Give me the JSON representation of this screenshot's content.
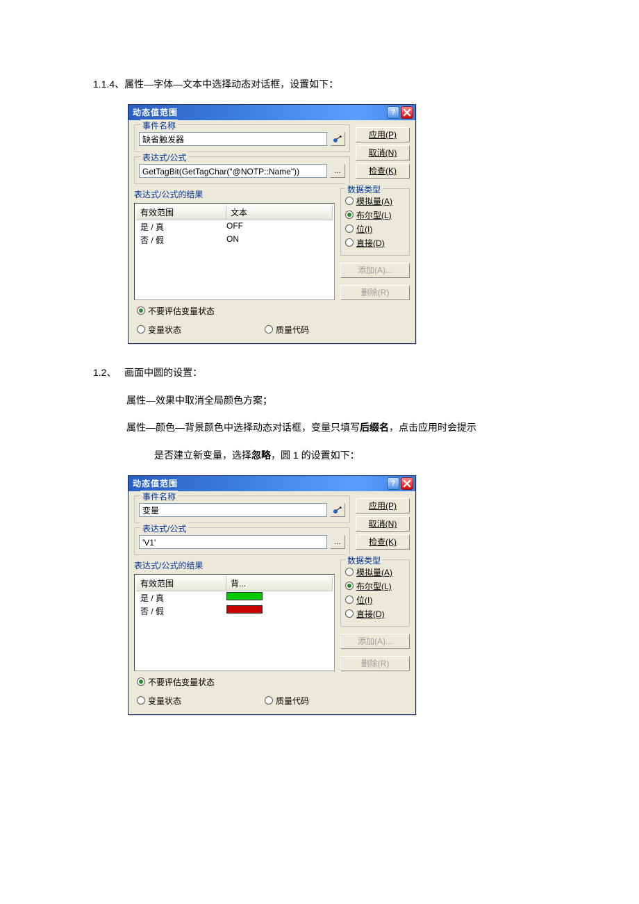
{
  "doc": {
    "p1": "1.1.4、属性—字体—文本中选择动态对话框，设置如下：",
    "p2a": "1.2、",
    "p2b": "画面中圆的设置：",
    "p3": "属性—效果中取消全局颜色方案；",
    "p4a": "属性—颜色—背景颜色中选择动态对话框，变量只填写",
    "p4b": "后缀名",
    "p4c": "，点击应用时会提示",
    "p5a": "是否建立新变量，选择",
    "p5b": "忽略",
    "p5c": "，圆 1 的设置如下："
  },
  "dialog1": {
    "title": "动态值范围",
    "event_group": "事件名称",
    "event_value": "缺省触发器",
    "expr_group": "表达式/公式",
    "expr_value": "GetTagBit(GetTagChar(\"@NOTP::Name\"))",
    "result_group": "表达式/公式的结果",
    "col_a": "有效范围",
    "col_b": "文本",
    "rows": [
      {
        "a": "是 / 真",
        "b": "OFF"
      },
      {
        "a": "否 / 假",
        "b": "ON"
      }
    ],
    "datatype_label": "数据类型",
    "radios": {
      "analog": "模拟量(A)",
      "bool": "布尔型(L)",
      "bit": "位(I)",
      "direct": "直接(D)"
    },
    "btns": {
      "apply": "应用(P)",
      "cancel": "取消(N)",
      "check": "检查(K)",
      "add": "添加(A)...",
      "remove": "删除(R)",
      "ellipsis": "..."
    },
    "bottom": {
      "noeval": "不要评估变量状态",
      "varstate": "变量状态",
      "quality": "质量代码"
    }
  },
  "dialog2": {
    "title": "动态值范围",
    "event_group": "事件名称",
    "event_value": "变量",
    "expr_group": "表达式/公式",
    "expr_value": "'V1'",
    "result_group": "表达式/公式的结果",
    "col_a": "有效范围",
    "col_b": "背...",
    "rows": [
      {
        "a": "是 / 真",
        "color": "green"
      },
      {
        "a": "否 / 假",
        "color": "red"
      }
    ],
    "datatype_label": "数据类型",
    "radios": {
      "analog": "模拟量(A)",
      "bool": "布尔型(L)",
      "bit": "位(I)",
      "direct": "直接(D)"
    },
    "btns": {
      "apply": "应用(P)",
      "cancel": "取消(N)",
      "check": "检查(K)",
      "add": "添加(A)...",
      "remove": "删除(R)",
      "ellipsis": "..."
    },
    "bottom": {
      "noeval": "不要评估变量状态",
      "varstate": "变量状态",
      "quality": "质量代码"
    }
  }
}
